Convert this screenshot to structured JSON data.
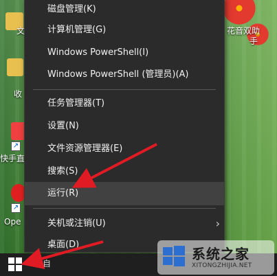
{
  "desktop": {
    "icons": [
      {
        "label": "文"
      },
      {
        "label": "收"
      },
      {
        "label": "快手直"
      },
      {
        "label": "Ope"
      },
      {
        "label": "花音双助"
      },
      {
        "label": "手"
      }
    ]
  },
  "menu": {
    "items": [
      {
        "label": "磁盘管理(K)"
      },
      {
        "label": "计算机管理(G)"
      },
      {
        "label": "Windows PowerShell(I)"
      },
      {
        "label": "Windows PowerShell (管理员)(A)"
      },
      {
        "label": "任务管理器(T)"
      },
      {
        "label": "设置(N)"
      },
      {
        "label": "文件资源管理器(E)"
      },
      {
        "label": "搜索(S)"
      },
      {
        "label": "运行(R)"
      },
      {
        "label": "关机或注销(U)",
        "submenu_arrow": "›"
      },
      {
        "label": "桌面(D)"
      }
    ],
    "highlighted": "运行(R)"
  },
  "taskbar": {
    "start_icon": "windows-logo-icon",
    "partial_text": "自"
  },
  "watermark": {
    "title": "系统之家",
    "url": "XITONGZHIJIA.NET"
  },
  "colors": {
    "menu_bg": "#2b2b2b",
    "menu_hover": "#414141",
    "arrow": "#e01b24",
    "taskbar": "#1f1f1f"
  }
}
